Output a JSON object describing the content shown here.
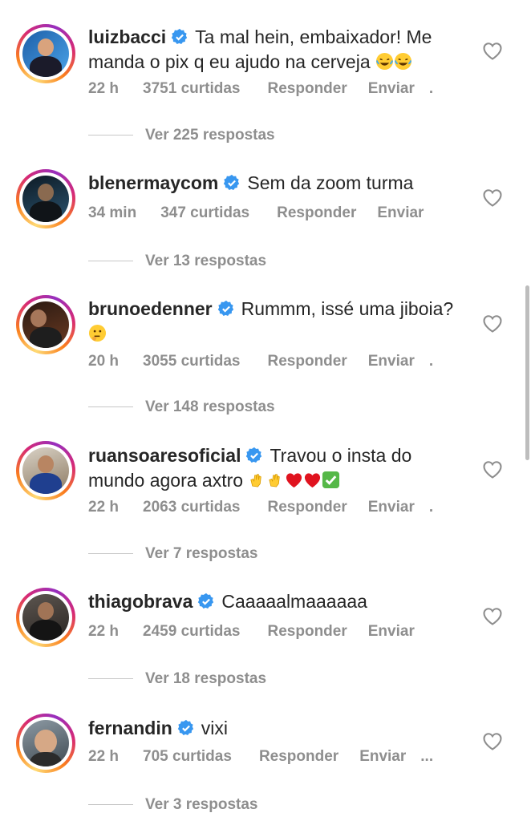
{
  "comments": [
    {
      "username": "luizbacci",
      "text": "Ta mal hein, embaixador! Me manda o pix q eu ajudo na cerveja",
      "time": "22 h",
      "likes": "3751 curtidas",
      "reply_label": "Responder",
      "send_label": "Enviar",
      "more": ".",
      "view_replies": "Ver 225 respostas"
    },
    {
      "username": "blenermaycom",
      "text": "Sem da zoom turma",
      "time": "34 min",
      "likes": "347 curtidas",
      "reply_label": "Responder",
      "send_label": "Enviar",
      "more": "",
      "view_replies": "Ver 13 respostas"
    },
    {
      "username": "brunoedenner",
      "text": "Rummm, issé uma jiboia?",
      "time": "20 h",
      "likes": "3055 curtidas",
      "reply_label": "Responder",
      "send_label": "Enviar",
      "more": ".",
      "view_replies": "Ver 148 respostas"
    },
    {
      "username": "ruansoaresoficial",
      "text": "Travou o insta do mundo agora axtro",
      "time": "22 h",
      "likes": "2063 curtidas",
      "reply_label": "Responder",
      "send_label": "Enviar",
      "more": ".",
      "view_replies": "Ver 7 respostas"
    },
    {
      "username": "thiagobrava",
      "text": "Caaaaalmaaaaaa",
      "time": "22 h",
      "likes": "2459 curtidas",
      "reply_label": "Responder",
      "send_label": "Enviar",
      "more": "",
      "view_replies": "Ver 18 respostas"
    },
    {
      "username": "fernandin",
      "text": "vixi",
      "time": "22 h",
      "likes": "705 curtidas",
      "reply_label": "Responder",
      "send_label": "Enviar",
      "more": "...",
      "view_replies": "Ver 3 respostas"
    }
  ],
  "icons": {
    "verified": "verified-badge-icon",
    "like": "heart-outline-icon"
  },
  "colors": {
    "verified_blue": "#3897f0",
    "muted_text": "#8e8e8e",
    "primary_text": "#262626"
  }
}
